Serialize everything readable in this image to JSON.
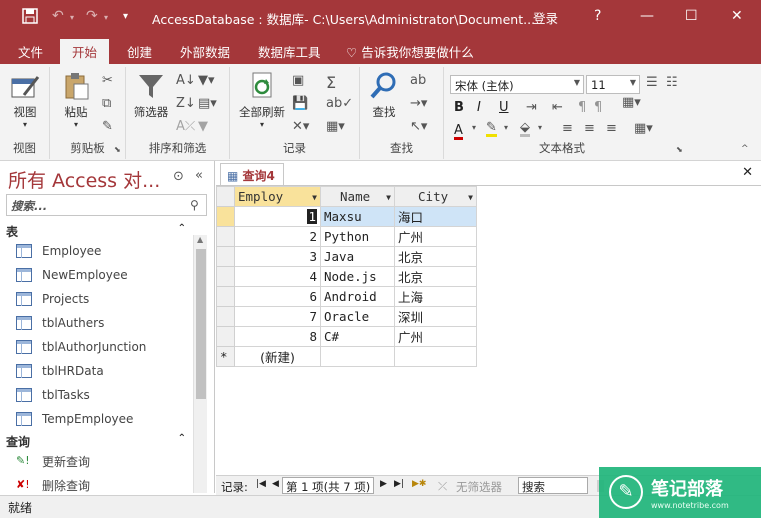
{
  "titlebar": {
    "title": "AccessDatabase : 数据库- C:\\Users\\Administrator\\Document...",
    "login": "登录",
    "help": "?",
    "minimize": "—",
    "maximize": "☐",
    "close": "✕",
    "qat_dropdown": "▾"
  },
  "tabs": [
    "文件",
    "开始",
    "创建",
    "外部数据",
    "数据库工具"
  ],
  "tellme": "告诉我你想要做什么",
  "ribbon": {
    "view_label": "视图",
    "view_group": "视图",
    "paste_label": "粘贴",
    "clipboard_group": "剪贴板",
    "filter_label": "筛选器",
    "sort_filter_group": "排序和筛选",
    "refresh_label": "全部刷新",
    "records_group": "记录",
    "find_label": "查找",
    "find_group": "查找",
    "font_name": "宋体 (主体)",
    "font_size": "11",
    "text_format_group": "文本格式",
    "bold": "B",
    "italic": "I",
    "underline": "U",
    "font_color": "A"
  },
  "nav": {
    "title": "所有 Access 对...",
    "search_placeholder": "搜索...",
    "section_tables": "表",
    "tables": [
      "Employee",
      "NewEmployee",
      "Projects",
      "tblAuthers",
      "tblAuthorJunction",
      "tblHRData",
      "tblTasks",
      "TempEmployee"
    ],
    "section_queries": "查询",
    "queries": [
      "更新查询",
      "删除查询"
    ]
  },
  "document": {
    "tab_label": "查询4",
    "columns": [
      "Employ",
      "Name",
      "City"
    ],
    "rows": [
      {
        "id": "1",
        "name": "Maxsu",
        "city": "海口"
      },
      {
        "id": "2",
        "name": "Python",
        "city": "广州"
      },
      {
        "id": "3",
        "name": "Java",
        "city": "北京"
      },
      {
        "id": "4",
        "name": "Node.js",
        "city": "北京"
      },
      {
        "id": "6",
        "name": "Android",
        "city": "上海"
      },
      {
        "id": "7",
        "name": "Oracle",
        "city": "深圳"
      },
      {
        "id": "8",
        "name": "C#",
        "city": "广州"
      }
    ],
    "new_row_marker": "*",
    "new_row_label": "(新建)"
  },
  "recnav": {
    "label": "记录:",
    "position": "第 1 项(共 7 项)",
    "filter": "无筛选器",
    "search": "搜索"
  },
  "status": {
    "text": "就绪"
  },
  "watermark": {
    "text": "笔记部落",
    "sub": "www.notetribe.com"
  },
  "colors": {
    "accent": "#a4373a",
    "ribbon_bg": "#f3f3f3",
    "selected_header": "#f9e29b",
    "selected_row": "#cfe4f7"
  }
}
